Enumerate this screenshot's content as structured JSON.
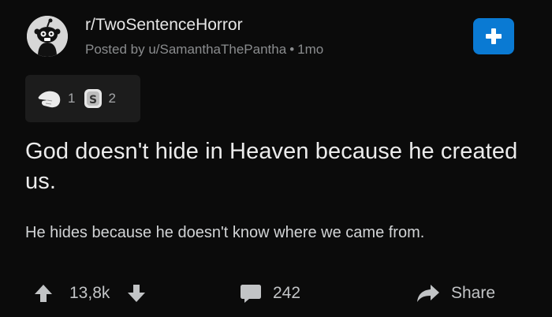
{
  "header": {
    "subreddit": "r/TwoSentenceHorror",
    "posted_by": "Posted by u/SamanthaThePantha",
    "separator": "•",
    "age": "1mo",
    "join_icon": "plus-icon",
    "join_color": "#0a7ad3"
  },
  "awards": [
    {
      "icon": "pointing-hand-award-icon",
      "count": "1"
    },
    {
      "icon": "silver-coin-award-icon",
      "count": "2"
    }
  ],
  "post": {
    "title": "God doesn't hide in Heaven because he created us.",
    "body": "He hides because he doesn't know where we came from."
  },
  "actions": {
    "score": "13,8k",
    "comments": "242",
    "share": "Share"
  },
  "colors": {
    "background": "#0b0b0b",
    "award_bg": "#1c1c1c",
    "text": "#ececec",
    "muted": "#8a8c8e"
  }
}
